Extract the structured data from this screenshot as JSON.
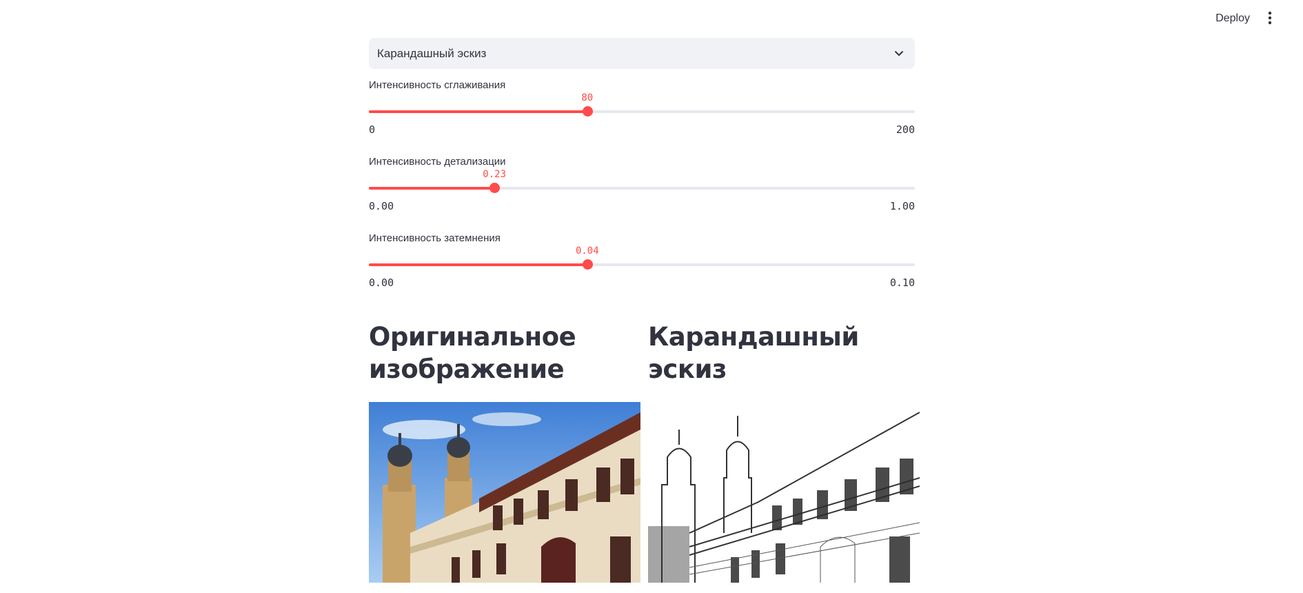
{
  "header": {
    "deploy_label": "Deploy",
    "menu_icon": "vertical-dots-icon"
  },
  "filter_select": {
    "selected": "Карандашный эскиз",
    "icon": "chevron-down-icon"
  },
  "sliders": [
    {
      "label": "Интенсивность сглаживания",
      "value": "80",
      "min": "0",
      "max": "200",
      "fraction": 0.4
    },
    {
      "label": "Интенсивность детализации",
      "value": "0.23",
      "min": "0.00",
      "max": "1.00",
      "fraction": 0.23
    },
    {
      "label": "Интенсивность затемнения",
      "value": "0.04",
      "min": "0.00",
      "max": "0.10",
      "fraction": 0.4
    }
  ],
  "columns": {
    "original_title": "Оригинальное изображение",
    "sketch_title": "Карандашный эскиз"
  },
  "colors": {
    "accent": "#ff4b4b",
    "text": "#31333f",
    "select_bg": "#f0f2f6",
    "track": "#e6e8ee"
  }
}
